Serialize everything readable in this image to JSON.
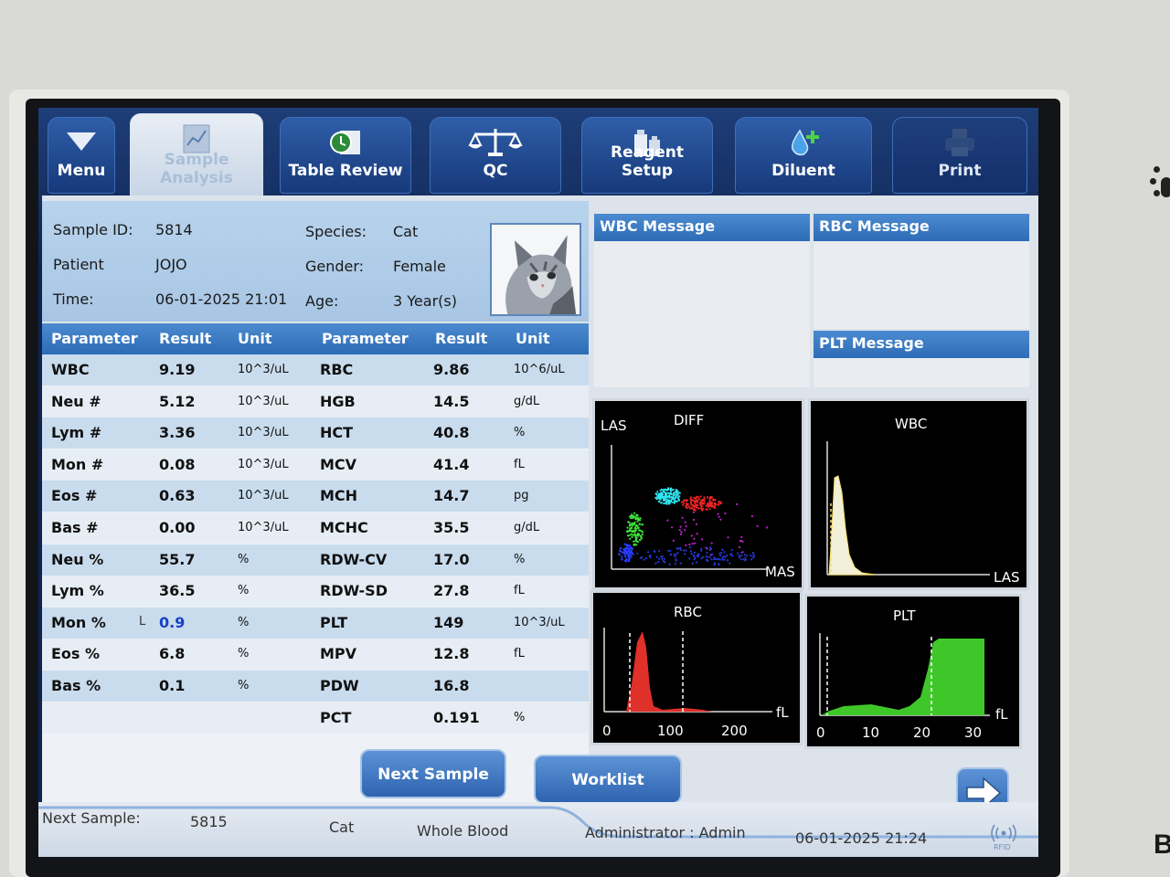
{
  "toolbar": {
    "menu": "Menu",
    "sample_analysis": "Sample Analysis",
    "table_review": "Table Review",
    "qc": "QC",
    "reagent_setup": "Reagent Setup",
    "diluent": "Diluent",
    "print": "Print"
  },
  "sample_info": {
    "sample_id_label": "Sample ID:",
    "sample_id": "5814",
    "patient_label": "Patient",
    "patient": "JOJO",
    "time_label": "Time:",
    "time": "06-01-2025 21:01",
    "species_label": "Species:",
    "species": "Cat",
    "gender_label": "Gender:",
    "gender": "Female",
    "age_label": "Age:",
    "age": "3 Year(s)"
  },
  "table": {
    "headers": {
      "parameter": "Parameter",
      "result": "Result",
      "unit": "Unit"
    },
    "left": [
      {
        "param": "WBC",
        "result": "9.19",
        "unit": "10^3/uL"
      },
      {
        "param": "Neu #",
        "result": "5.12",
        "unit": "10^3/uL"
      },
      {
        "param": "Lym #",
        "result": "3.36",
        "unit": "10^3/uL"
      },
      {
        "param": "Mon #",
        "result": "0.08",
        "unit": "10^3/uL"
      },
      {
        "param": "Eos #",
        "result": "0.63",
        "unit": "10^3/uL"
      },
      {
        "param": "Bas #",
        "result": "0.00",
        "unit": "10^3/uL"
      },
      {
        "param": "Neu %",
        "result": "55.7",
        "unit": "%"
      },
      {
        "param": "Lym %",
        "result": "36.5",
        "unit": "%"
      },
      {
        "param": "Mon %",
        "flag": "L",
        "result": "0.9",
        "unit": "%"
      },
      {
        "param": "Eos %",
        "result": "6.8",
        "unit": "%"
      },
      {
        "param": "Bas %",
        "result": "0.1",
        "unit": "%"
      }
    ],
    "right": [
      {
        "param": "RBC",
        "result": "9.86",
        "unit": "10^6/uL"
      },
      {
        "param": "HGB",
        "result": "14.5",
        "unit": "g/dL"
      },
      {
        "param": "HCT",
        "result": "40.8",
        "unit": "%"
      },
      {
        "param": "MCV",
        "result": "41.4",
        "unit": "fL"
      },
      {
        "param": "MCH",
        "result": "14.7",
        "unit": "pg"
      },
      {
        "param": "MCHC",
        "result": "35.5",
        "unit": "g/dL"
      },
      {
        "param": "RDW-CV",
        "result": "17.0",
        "unit": "%"
      },
      {
        "param": "RDW-SD",
        "result": "27.8",
        "unit": "fL"
      },
      {
        "param": "PLT",
        "result": "149",
        "unit": "10^3/uL"
      },
      {
        "param": "MPV",
        "result": "12.8",
        "unit": "fL"
      },
      {
        "param": "PDW",
        "result": "16.8",
        "unit": ""
      },
      {
        "param": "PCT",
        "result": "0.191",
        "unit": "%"
      }
    ]
  },
  "messages": {
    "wbc": "WBC Message",
    "rbc": "RBC Message",
    "plt": "PLT Message"
  },
  "plots": {
    "diff": {
      "title": "DIFF",
      "ylabel": "LAS",
      "xlabel": "MAS"
    },
    "wbc": {
      "title": "WBC",
      "xlabel": "LAS"
    },
    "rbc": {
      "title": "RBC",
      "unit": "fL",
      "ticks": [
        "0",
        "100",
        "200"
      ]
    },
    "plt": {
      "title": "PLT",
      "unit": "fL",
      "ticks": [
        "0",
        "10",
        "20",
        "30"
      ]
    }
  },
  "buttons": {
    "next_sample": "Next Sample",
    "worklist": "Worklist"
  },
  "status": {
    "next_sample_label": "Next Sample:",
    "next_sample_id": "5815",
    "species": "Cat",
    "sample_type": "Whole Blood",
    "user": "Administrator : Admin",
    "datetime": "06-01-2025 21:24",
    "rfid": "RFID"
  },
  "colors": {
    "header_blue": "#2d6cb6",
    "low_flag": "#1742c8",
    "rbc_curve": "#e0302a",
    "plt_curve": "#3fc72a",
    "wbc_curve": "#f2f0d8"
  }
}
